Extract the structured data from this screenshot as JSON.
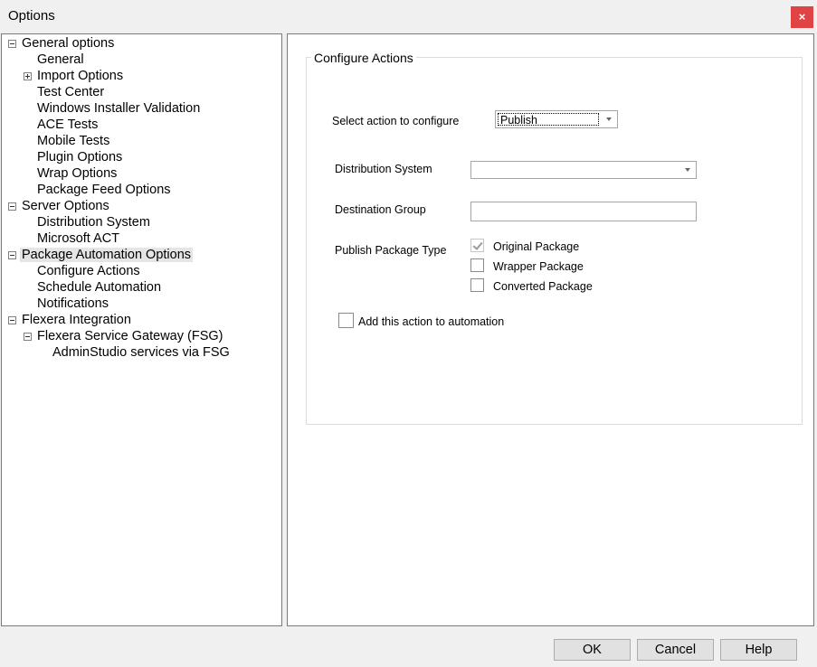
{
  "window": {
    "title": "Options",
    "close_icon": "close-icon",
    "close_glyph": "×"
  },
  "tree": [
    {
      "label": "General options",
      "toggle": "minus"
    },
    {
      "label": "General"
    },
    {
      "label": "Import Options",
      "toggle": "plus"
    },
    {
      "label": "Test Center"
    },
    {
      "label": "Windows Installer Validation"
    },
    {
      "label": "ACE Tests"
    },
    {
      "label": "Mobile Tests"
    },
    {
      "label": "Plugin Options"
    },
    {
      "label": "Wrap Options"
    },
    {
      "label": "Package Feed Options"
    },
    {
      "label": "Server Options",
      "toggle": "minus"
    },
    {
      "label": "Distribution System"
    },
    {
      "label": "Microsoft ACT"
    },
    {
      "label": "Package Automation Options",
      "toggle": "minus",
      "selected": true
    },
    {
      "label": "Configure Actions"
    },
    {
      "label": "Schedule Automation"
    },
    {
      "label": "Notifications"
    },
    {
      "label": "Flexera Integration",
      "toggle": "minus"
    },
    {
      "label": "Flexera Service Gateway (FSG)",
      "toggle": "minus"
    },
    {
      "label": "AdminStudio services via FSG"
    }
  ],
  "configure": {
    "group_title": "Configure Actions",
    "select_action_label": "Select action to configure",
    "select_action_value": "Publish",
    "distribution_system_label": "Distribution System",
    "distribution_system_value": "",
    "destination_group_label": "Destination Group",
    "destination_group_value": "",
    "publish_type_label": "Publish Package Type",
    "package_types": [
      {
        "label": "Original Package",
        "checked": true,
        "enabled": false
      },
      {
        "label": "Wrapper Package",
        "checked": false,
        "enabled": true
      },
      {
        "label": "Converted Package",
        "checked": false,
        "enabled": true
      }
    ],
    "add_to_automation_label": "Add this action to automation",
    "add_to_automation_checked": false
  },
  "buttons": {
    "ok": "OK",
    "cancel": "Cancel",
    "help": "Help"
  }
}
